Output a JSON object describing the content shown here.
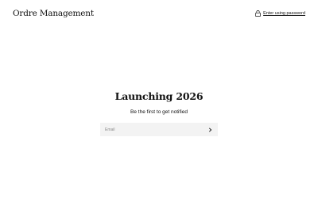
{
  "header": {
    "brand": "Ordre Management",
    "password_link": {
      "label": "Enter using password",
      "icon": "lock-icon"
    }
  },
  "hero": {
    "title": "Launching 2026",
    "subtitle": "Be the first to get notified"
  },
  "signup": {
    "email_placeholder": "Email",
    "email_value": "",
    "submit_icon": "chevron-right-icon"
  },
  "colors": {
    "text": "#121212",
    "input_background": "#f3f3f3",
    "placeholder": "#8a8a8a",
    "page_background": "#ffffff"
  }
}
